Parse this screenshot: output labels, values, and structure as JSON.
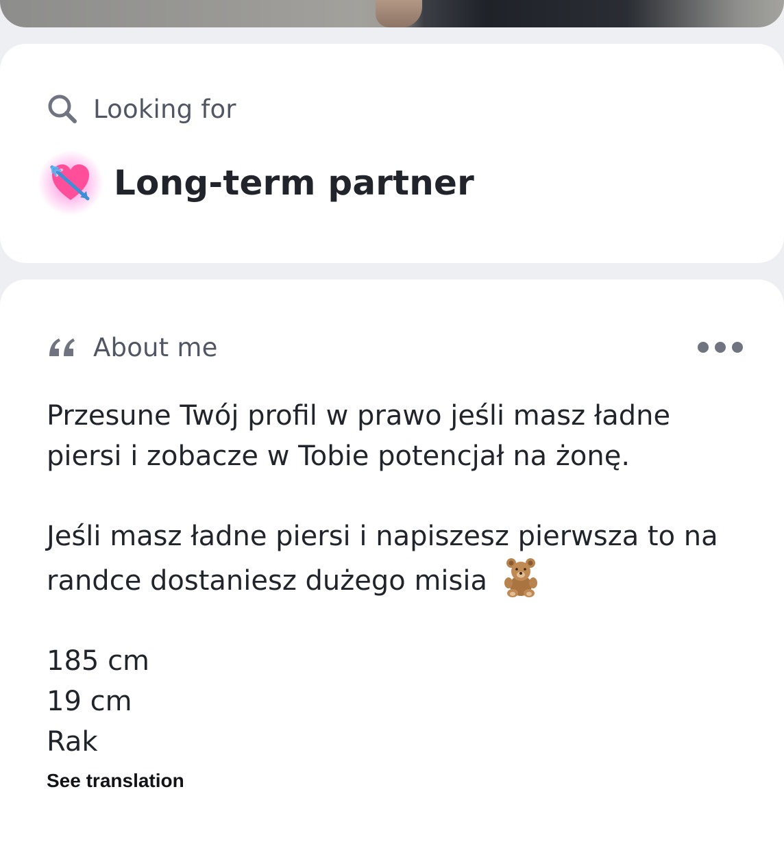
{
  "looking_for": {
    "heading": "Looking for",
    "icon": "search-icon",
    "value_emoji": "heart-with-arrow-icon",
    "value": "Long-term partner"
  },
  "about_me": {
    "heading": "About me",
    "icon": "quote-icon",
    "menu_icon": "more-options-icon",
    "paragraphs": [
      "Przesune Twój profil w prawo jeśli masz ładne piersi i zobacze w Tobie potencjał na żonę.",
      "Jeśli masz ładne piersi i napiszesz pierwsza to na randce dostaniesz dużego misia"
    ],
    "paragraph_emoji": "teddy-bear-icon",
    "facts": [
      "185 cm",
      "19 cm",
      "Rak"
    ],
    "translation_link": "See translation"
  },
  "colors": {
    "background": "#eeeff3",
    "card": "#ffffff",
    "heading_text": "#505663",
    "body_text": "#21252b",
    "icon_gray": "#6f7480",
    "glow_pink": "#ff5ac8"
  }
}
